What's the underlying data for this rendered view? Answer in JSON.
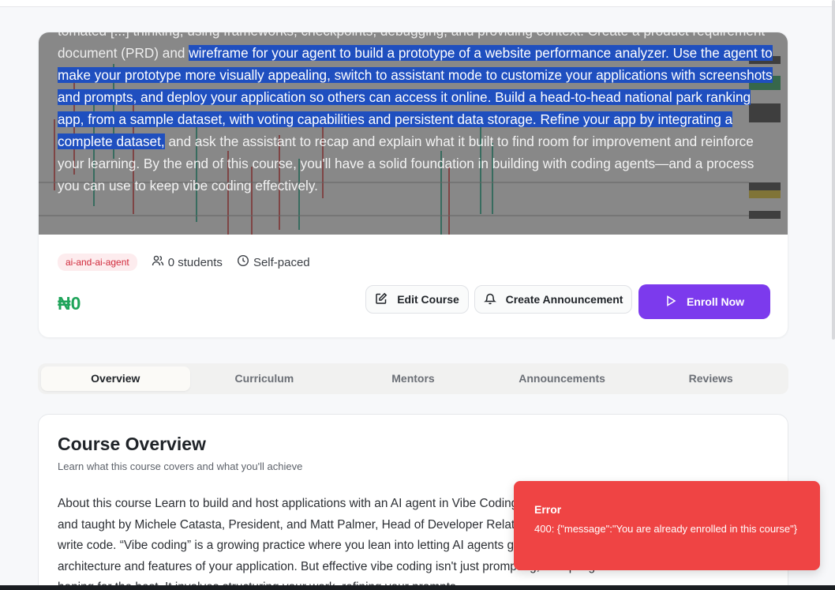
{
  "course": {
    "description_pre": "tomated [...] thinking, using frameworks, checkpoints, debugging, and providing context. Create a product requirement document (PRD) and",
    "description_sel": "wireframe for your agent to build a prototype of a website performance analyzer. Use the agent to make your prototype more visually appealing, switch to assistant mode to customize your applications with screenshots and prompts, and deploy your application so others can access it online. Build a head-to-head national park ranking app, from a sample dataset, with voting capabilities and persistent data storage. Refine your app by integrating a complete dataset,",
    "description_post": "and ask the assistant to recap and explain what it built to find room for improvement and reinforce your learning. By the end of this course, you'll have a solid foundation in building with coding agents—and a process you can use to keep vibe coding effectively.",
    "tag": "ai-and-ai-agent",
    "students": "0 students",
    "pace": "Self-paced",
    "price": "₦0"
  },
  "actions": {
    "edit": "Edit Course",
    "announce": "Create Announcement",
    "enroll": "Enroll Now"
  },
  "tabs": [
    "Overview",
    "Curriculum",
    "Mentors",
    "Announcements",
    "Reviews"
  ],
  "overview": {
    "title": "Course Overview",
    "subtitle": "Learn what this course covers and what you'll achieve",
    "body": "About this course Learn to build and host applications with an AI agent in Vibe Coding 101 with Replit, built in partnership with Replit and taught by Michele Catasta, President, and Matt Palmer, Head of Developer Relations. Coding agents are changing how we write code. “Vibe coding” is a growing practice where you lean into letting AI agents generate code while you focus on the architecture and features of your application. But effective vibe coding isn't just prompting, accepting all recommendations and hoping for the best. It involves structuring your work, refining your prompts"
  },
  "toast": {
    "title": "Error",
    "message": "400: {\"message\":\"You are already enrolled in this course\"}"
  },
  "colors": {
    "accent": "#7c3aed",
    "price": "#1fa45a",
    "error": "#ef4444",
    "tag_text": "#d1293b"
  },
  "icons": [
    "edit-icon",
    "bell-icon",
    "play-icon",
    "users-icon",
    "clock-icon"
  ]
}
